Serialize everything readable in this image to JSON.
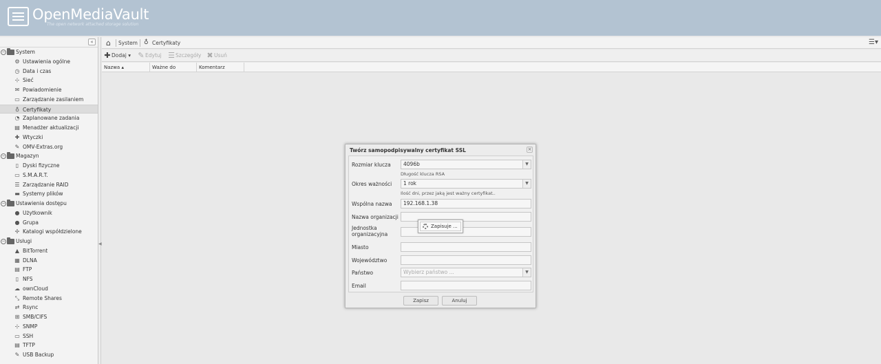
{
  "header": {
    "title": "OpenMediaVault",
    "subtitle": "The open network attached storage solution"
  },
  "sidebar": {
    "collapse_glyph": "«",
    "tree": [
      {
        "type": "cat",
        "label": "System",
        "icon": "folder-icon"
      },
      {
        "type": "item",
        "label": "Ustawienia ogólne",
        "icon": "wrench-icon",
        "glyph": "⚙"
      },
      {
        "type": "item",
        "label": "Data i czas",
        "icon": "clock-icon",
        "glyph": "◷"
      },
      {
        "type": "item",
        "label": "Sieć",
        "icon": "network-icon",
        "glyph": "⊹"
      },
      {
        "type": "item",
        "label": "Powiadomienie",
        "icon": "mail-icon",
        "glyph": "✉"
      },
      {
        "type": "item",
        "label": "Zarządzanie zasilaniem",
        "icon": "power-icon",
        "glyph": "▭"
      },
      {
        "type": "item",
        "label": "Certyfikaty",
        "icon": "certificate-icon",
        "glyph": "♁",
        "selected": true
      },
      {
        "type": "item",
        "label": "Zaplanowane zadania",
        "icon": "alarm-icon",
        "glyph": "◔"
      },
      {
        "type": "item",
        "label": "Menadżer aktualizacji",
        "icon": "update-icon",
        "glyph": "▤"
      },
      {
        "type": "item",
        "label": "Wtyczki",
        "icon": "plugin-icon",
        "glyph": "✚"
      },
      {
        "type": "item",
        "label": "OMV-Extras.org",
        "icon": "extras-icon",
        "glyph": "✎"
      },
      {
        "type": "cat",
        "label": "Magazyn",
        "icon": "folder-icon"
      },
      {
        "type": "item",
        "label": "Dyski fizyczne",
        "icon": "disk-icon",
        "glyph": "▯"
      },
      {
        "type": "item",
        "label": "S.M.A.R.T.",
        "icon": "smart-icon",
        "glyph": "▭"
      },
      {
        "type": "item",
        "label": "Zarządzanie RAID",
        "icon": "raid-icon",
        "glyph": "☰"
      },
      {
        "type": "item",
        "label": "Systemy plików",
        "icon": "filesystem-icon",
        "glyph": "▬"
      },
      {
        "type": "cat",
        "label": "Ustawienia dostępu",
        "icon": "folder-icon"
      },
      {
        "type": "item",
        "label": "Użytkownik",
        "icon": "user-icon",
        "glyph": "●"
      },
      {
        "type": "item",
        "label": "Grupa",
        "icon": "group-icon",
        "glyph": "●"
      },
      {
        "type": "item",
        "label": "Katalogi współdzielone",
        "icon": "share-icon",
        "glyph": "✢"
      },
      {
        "type": "cat",
        "label": "Usługi",
        "icon": "folder-icon"
      },
      {
        "type": "item",
        "label": "BitTorrent",
        "icon": "bittorrent-icon",
        "glyph": "▲"
      },
      {
        "type": "item",
        "label": "DLNA",
        "icon": "dlna-icon",
        "glyph": "▦"
      },
      {
        "type": "item",
        "label": "FTP",
        "icon": "ftp-icon",
        "glyph": "▤"
      },
      {
        "type": "item",
        "label": "NFS",
        "icon": "nfs-icon",
        "glyph": "▯"
      },
      {
        "type": "item",
        "label": "ownCloud",
        "icon": "cloud-icon",
        "glyph": "☁"
      },
      {
        "type": "item",
        "label": "Remote Shares",
        "icon": "remote-icon",
        "glyph": "⤡"
      },
      {
        "type": "item",
        "label": "Rsync",
        "icon": "rsync-icon",
        "glyph": "⇄"
      },
      {
        "type": "item",
        "label": "SMB/CIFS",
        "icon": "windows-icon",
        "glyph": "⊞"
      },
      {
        "type": "item",
        "label": "SNMP",
        "icon": "snmp-icon",
        "glyph": "⊹"
      },
      {
        "type": "item",
        "label": "SSH",
        "icon": "terminal-icon",
        "glyph": "▭"
      },
      {
        "type": "item",
        "label": "TFTP",
        "icon": "tftp-icon",
        "glyph": "▤"
      },
      {
        "type": "item",
        "label": "USB Backup",
        "icon": "usb-icon",
        "glyph": "✎"
      }
    ]
  },
  "breadcrumb": {
    "home_icon": "⌂",
    "items": [
      "System",
      "Certyfikaty"
    ]
  },
  "toolbar": {
    "add": "Dodaj",
    "edit": "Edytuj",
    "details": "Szczegóły",
    "delete": "Usuń"
  },
  "grid": {
    "columns": [
      "Nazwa",
      "Ważne do",
      "Komentarz"
    ]
  },
  "dialog": {
    "title": "Twórz samopodpisywalny certyfikat SSL",
    "fields": {
      "key_size": {
        "label": "Rozmiar klucza",
        "value": "4096b",
        "hint": "Długość klucza RSA"
      },
      "validity": {
        "label": "Okres ważności",
        "value": "1 rok",
        "hint": "Ilość dni, przez jaką jest ważny certyfikat.."
      },
      "common_name": {
        "label": "Wspólna nazwa",
        "value": "192.168.1.38"
      },
      "organization": {
        "label": "Nazwa organizacji",
        "value": ""
      },
      "unit": {
        "label": "Jednostka organizacyjna",
        "value": ""
      },
      "city": {
        "label": "Miasto",
        "value": ""
      },
      "state": {
        "label": "Województwo",
        "value": ""
      },
      "country": {
        "label": "Państwo",
        "placeholder": "Wybierz państwo ..."
      },
      "email": {
        "label": "Email",
        "value": ""
      }
    },
    "save": "Zapisz",
    "cancel": "Anuluj",
    "loading": "Zapisuje ..."
  },
  "colors": {
    "header_bg": "#b3c3d2",
    "page_bg": "#e9e9e9"
  }
}
